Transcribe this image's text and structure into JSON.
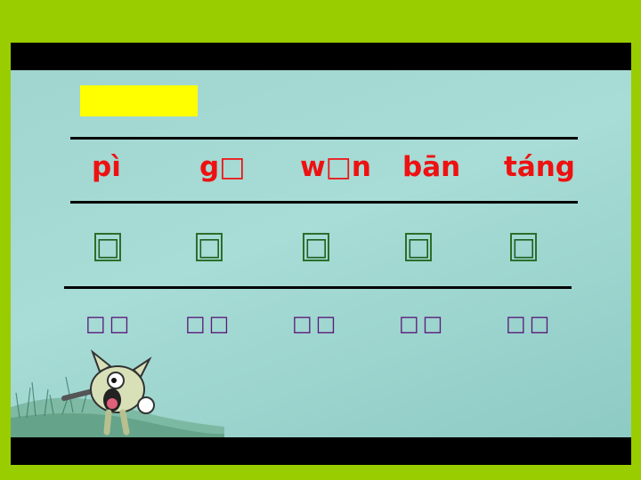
{
  "pinyin": [
    "pì",
    "g□",
    "w□n",
    "bān",
    "táng"
  ],
  "characters": [
    "□",
    "□",
    "□",
    "□",
    "□"
  ],
  "words": [
    "□□",
    "□□",
    "□□",
    "□□",
    "□□"
  ],
  "colors": {
    "border": "#9acd00",
    "pinyin": "#ee1111",
    "highlight": "#ffff00",
    "words": "#5a1a7a"
  },
  "icons": {
    "mascot": "cartoon-dog-mascot-icon"
  }
}
